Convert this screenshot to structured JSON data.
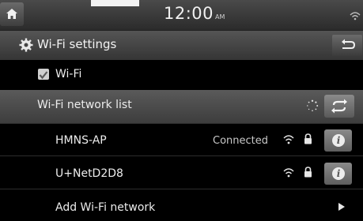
{
  "status_bar": {
    "time": "12:00",
    "ampm": "AM"
  },
  "header": {
    "title": "Wi-Fi settings"
  },
  "wifi_toggle": {
    "label": "Wi-Fi",
    "checked": true
  },
  "network_list": {
    "header": "Wi-Fi network list",
    "networks": [
      {
        "ssid": "HMNS-AP",
        "status": "Connected",
        "secured": true
      },
      {
        "ssid": "U+NetD2D8",
        "status": "",
        "secured": true
      }
    ],
    "add_label": "Add Wi-Fi network"
  },
  "icons": {
    "home": "home-icon",
    "settings": "gear-icon",
    "back": "back-arrow-icon",
    "wifi": "wifi-icon",
    "lock": "lock-icon",
    "info": "info-icon",
    "refresh": "refresh-icon",
    "spinner": "loading-spinner-icon",
    "arrow": "chevron-right-icon"
  }
}
